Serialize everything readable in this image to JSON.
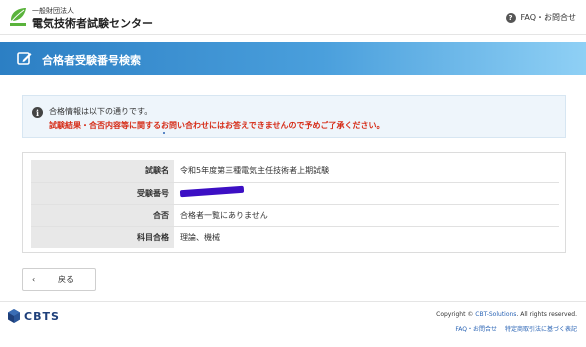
{
  "header": {
    "org_sub": "一般財団法人",
    "org_main": "電気技術者試験センター",
    "faq_label": "FAQ・お問合せ",
    "help_icon_glyph": "?"
  },
  "banner": {
    "title": "合格者受験番号検索"
  },
  "notice": {
    "icon_glyph": "i",
    "line1": "合格情報は以下の通りです。",
    "line2": "試験結果・合否内容等に関するお問い合わせにはお答えできませんので予めご了承ください。"
  },
  "result": {
    "rows": [
      {
        "label": "試験名",
        "value": "令和5年度第三種電気主任技術者上期試験"
      },
      {
        "label": "受験番号",
        "value": ""
      },
      {
        "label": "合否",
        "value": "合格者一覧にありません"
      },
      {
        "label": "科目合格",
        "value": "理論、機械"
      }
    ]
  },
  "back_button": {
    "arrow": "‹",
    "label": "戻る"
  },
  "footer": {
    "brand": "CBTS",
    "copyright_prefix": "Copyright © ",
    "copyright_link": "CBT-Solutions",
    "copyright_suffix": ". All rights reserved.",
    "link_faq": "FAQ・お問合せ",
    "link_law": "特定商取引法に基づく表記"
  },
  "colors": {
    "banner_start": "#2c7fc4",
    "banner_end": "#8fd0f5",
    "warning_red": "#d62b16",
    "link_blue": "#2a64b5",
    "redaction_purple": "#3c0fc4"
  },
  "icons": {
    "logo": "leaf-logo-icon",
    "help": "question-circle-icon",
    "banner": "edit-icon",
    "notice": "info-circle-icon",
    "back": "chevron-left-icon",
    "footer_logo": "cbts-cube-icon"
  }
}
